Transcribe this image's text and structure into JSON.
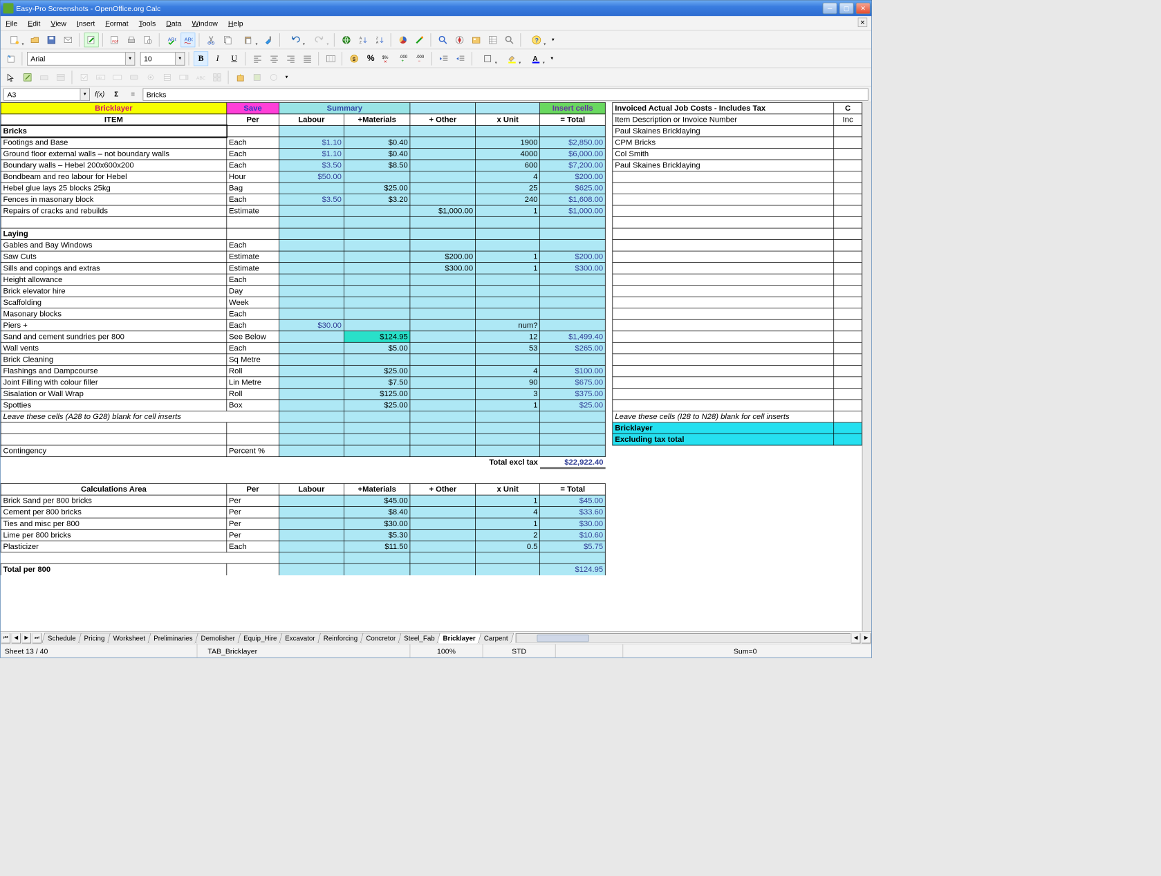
{
  "window": {
    "title": "Easy-Pro Screenshots - OpenOffice.org Calc"
  },
  "menu": [
    "File",
    "Edit",
    "View",
    "Insert",
    "Format",
    "Tools",
    "Data",
    "Window",
    "Help"
  ],
  "format_row": {
    "font": "Arial",
    "size": "10"
  },
  "cellref": {
    "ref": "A3",
    "value": "Bricks"
  },
  "buttons": {
    "save": "Save",
    "summary": "Summary",
    "insert_cells": "Insert cells",
    "bricklayer": "Bricklayer"
  },
  "rightpanel": {
    "header1": "Invoiced Actual Job Costs - Includes Tax",
    "header1b": "C",
    "header2": "Item Description or Invoice Number",
    "header2b": "Inc",
    "rows": [
      "Paul Skaines Bricklaying",
      "CPM Bricks",
      "Col Smith",
      "Paul Skaines Bricklaying"
    ],
    "note": "Leave these cells (I28 to N28) blank for cell inserts",
    "brick": "Bricklayer",
    "excl": "Excluding tax total"
  },
  "headers": [
    "ITEM",
    "Per",
    "Labour",
    "+Materials",
    "+ Other",
    "x Unit",
    "=  Total"
  ],
  "sections": {
    "bricks": "Bricks",
    "laying": "Laying",
    "calc": "Calculations Area"
  },
  "rows": [
    {
      "item": "Footings and Base",
      "per": "Each",
      "labour": "$1.10",
      "mat": "$0.40",
      "oth": "",
      "unit": "1900",
      "tot": "$2,850.00"
    },
    {
      "item": "Ground floor external walls – not boundary walls",
      "per": "Each",
      "labour": "$1.10",
      "mat": "$0.40",
      "oth": "",
      "unit": "4000",
      "tot": "$6,000.00"
    },
    {
      "item": "Boundary walls  – Hebel 200x600x200",
      "per": "Each",
      "labour": "$3.50",
      "mat": "$8.50",
      "oth": "",
      "unit": "600",
      "tot": "$7,200.00"
    },
    {
      "item": "Bondbeam and reo labour for Hebel",
      "per": "Hour",
      "labour": "$50.00",
      "mat": "",
      "oth": "",
      "unit": "4",
      "tot": "$200.00"
    },
    {
      "item": "Hebel glue  lays 25 blocks 25kg",
      "per": "Bag",
      "labour": "",
      "mat": "$25.00",
      "oth": "",
      "unit": "25",
      "tot": "$625.00"
    },
    {
      "item": "Fences in masonary block",
      "per": "Each",
      "labour": "$3.50",
      "mat": "$3.20",
      "oth": "",
      "unit": "240",
      "tot": "$1,608.00"
    },
    {
      "item": "Repairs of cracks and rebuilds",
      "per": "Estimate",
      "labour": "",
      "mat": "",
      "oth": "$1,000.00",
      "unit": "1",
      "tot": "$1,000.00"
    }
  ],
  "rows2": [
    {
      "item": "Gables and Bay Windows",
      "per": "Each",
      "labour": "",
      "mat": "",
      "oth": "",
      "unit": "",
      "tot": ""
    },
    {
      "item": "Saw Cuts",
      "per": "Estimate",
      "labour": "",
      "mat": "",
      "oth": "$200.00",
      "unit": "1",
      "tot": "$200.00"
    },
    {
      "item": "Sills and copings and extras",
      "per": "Estimate",
      "labour": "",
      "mat": "",
      "oth": "$300.00",
      "unit": "1",
      "tot": "$300.00"
    },
    {
      "item": "Height allowance",
      "per": "Each",
      "labour": "",
      "mat": "",
      "oth": "",
      "unit": "",
      "tot": ""
    },
    {
      "item": "Brick elevator hire",
      "per": "Day",
      "labour": "",
      "mat": "",
      "oth": "",
      "unit": "",
      "tot": ""
    },
    {
      "item": "Scaffolding",
      "per": "Week",
      "labour": "",
      "mat": "",
      "oth": "",
      "unit": "",
      "tot": ""
    },
    {
      "item": "Masonary blocks",
      "per": "Each",
      "labour": "",
      "mat": "",
      "oth": "",
      "unit": "",
      "tot": ""
    },
    {
      "item": "Piers +",
      "per": "Each",
      "labour": "$30.00",
      "mat": "",
      "oth": "",
      "unit": "num?",
      "tot": ""
    },
    {
      "item": "Sand and cement sundries per 800",
      "per": "See Below",
      "labour": "",
      "mat": "$124.95",
      "oth": "",
      "unit": "12",
      "tot": "$1,499.40",
      "hl": true
    },
    {
      "item": "Wall vents",
      "per": "Each",
      "labour": "",
      "mat": "$5.00",
      "oth": "",
      "unit": "53",
      "tot": "$265.00"
    },
    {
      "item": "Brick Cleaning",
      "per": "Sq Metre",
      "labour": "",
      "mat": "",
      "oth": "",
      "unit": "",
      "tot": ""
    },
    {
      "item": "Flashings and Dampcourse",
      "per": "Roll",
      "labour": "",
      "mat": "$25.00",
      "oth": "",
      "unit": "4",
      "tot": "$100.00"
    },
    {
      "item": "Joint Filling with colour filler",
      "per": "Lin Metre",
      "labour": "",
      "mat": "$7.50",
      "oth": "",
      "unit": "90",
      "tot": "$675.00"
    },
    {
      "item": "Sisalation or Wall Wrap",
      "per": "Roll",
      "labour": "",
      "mat": "$125.00",
      "oth": "",
      "unit": "3",
      "tot": "$375.00"
    },
    {
      "item": "Spotties",
      "per": "Box",
      "labour": "",
      "mat": "$25.00",
      "oth": "",
      "unit": "1",
      "tot": "$25.00"
    }
  ],
  "note_left": "Leave these cells (A28 to G28) blank for cell inserts",
  "contingency": {
    "item": "Contingency",
    "per": "Percent %"
  },
  "totals": {
    "label": "Total excl tax",
    "val": "$22,922.40"
  },
  "calc_rows": [
    {
      "item": "Brick Sand per 800 bricks",
      "per": "Per",
      "mat": "$45.00",
      "unit": "1",
      "tot": "$45.00"
    },
    {
      "item": "Cement per 800 bricks",
      "per": "Per",
      "mat": "$8.40",
      "unit": "4",
      "tot": "$33.60"
    },
    {
      "item": "Ties and misc per 800",
      "per": "Per",
      "mat": "$30.00",
      "unit": "1",
      "tot": "$30.00"
    },
    {
      "item": "Lime per 800 bricks",
      "per": "Per",
      "mat": "$5.30",
      "unit": "2",
      "tot": "$10.60"
    },
    {
      "item": "Plasticizer",
      "per": "Each",
      "mat": "$11.50",
      "unit": "0.5",
      "tot": "$5.75"
    }
  ],
  "lastrow": {
    "item": "Total per 800",
    "tot": "$124.95"
  },
  "tabs": [
    "Schedule",
    "Pricing",
    "Worksheet",
    "Preliminaries",
    "Demolisher",
    "Equip_Hire",
    "Excavator",
    "Reinforcing",
    "Concretor",
    "Steel_Fab",
    "Bricklayer",
    "Carpent"
  ],
  "active_tab": "Bricklayer",
  "status": {
    "sheet": "Sheet 13 / 40",
    "tab": "TAB_Bricklayer",
    "zoom": "100%",
    "mode": "STD",
    "sum": "Sum=0"
  }
}
